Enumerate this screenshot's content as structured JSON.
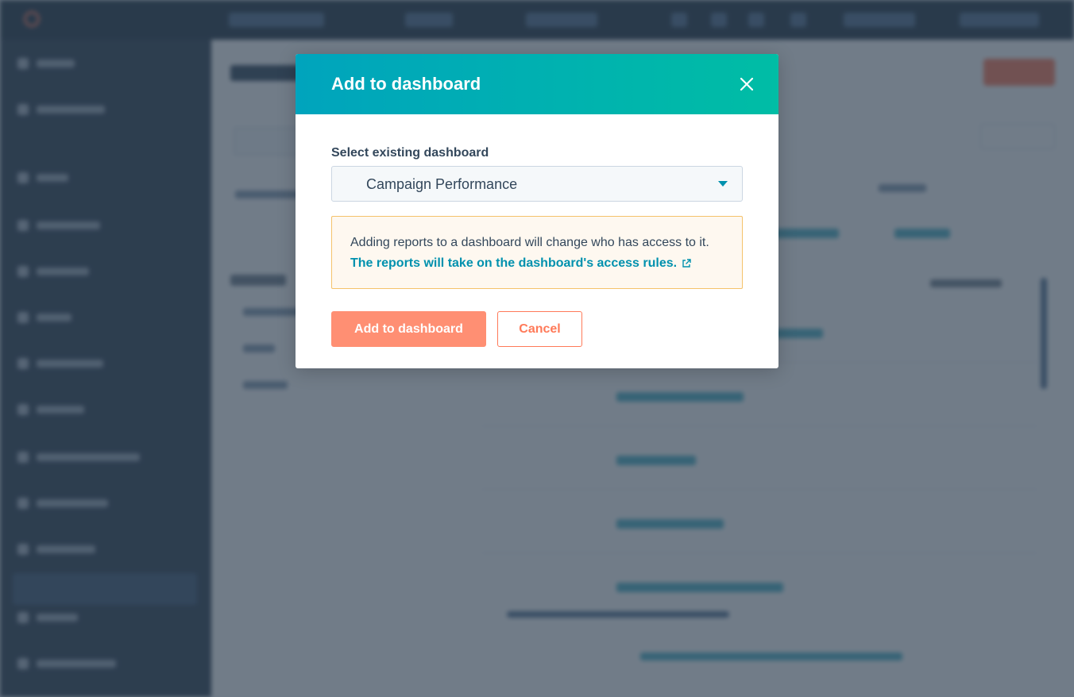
{
  "modal": {
    "title": "Add to dashboard",
    "close_icon": "close-icon",
    "field_label": "Select existing dashboard",
    "selected_dashboard": "Campaign Performance",
    "alert_text": "Adding reports to a dashboard will change who has access to it.",
    "alert_link": "The reports will take on the dashboard's access rules.",
    "external_link_icon": "external-link-icon",
    "primary_button": "Add to dashboard",
    "cancel_button": "Cancel"
  },
  "colors": {
    "header_gradient_start": "#00a4bd",
    "header_gradient_end": "#00bda5",
    "link": "#0091ae",
    "primary_button": "#ff8f73",
    "cancel_border": "#ff7a59",
    "alert_bg": "#fef8f0",
    "alert_border": "#f5c26b",
    "overlay": "#2d3e50"
  }
}
